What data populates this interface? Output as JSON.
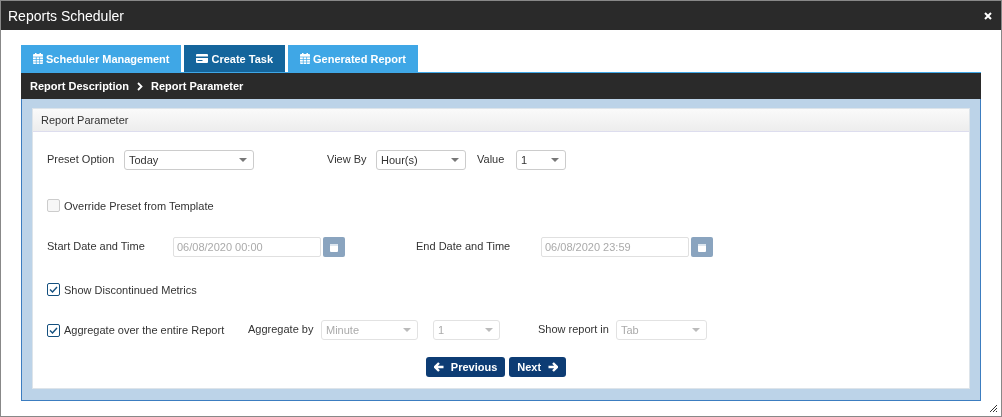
{
  "window": {
    "title": "Reports Scheduler"
  },
  "tabs": [
    {
      "label": "Scheduler Management",
      "kind": "calendar",
      "selected": false
    },
    {
      "label": "Create Task",
      "kind": "card",
      "selected": true
    },
    {
      "label": "Generated Report",
      "kind": "calendar",
      "selected": false
    }
  ],
  "breadcrumb": [
    "Report Description",
    "Report Parameter"
  ],
  "panel": {
    "title": "Report Parameter"
  },
  "preset_option": {
    "label": "Preset Option",
    "value": "Today",
    "disabled": false
  },
  "view_by": {
    "label": "View By",
    "value": "Hour(s)",
    "disabled": false
  },
  "value": {
    "label": "Value",
    "value": "1",
    "disabled": false
  },
  "override_preset": {
    "label": "Override Preset from Template",
    "checked": false,
    "disabled": true
  },
  "start": {
    "label": "Start Date and Time",
    "value": "06/08/2020 00:00",
    "disabled": true
  },
  "end": {
    "label": "End Date and Time",
    "value": "06/08/2020 23:59",
    "disabled": true
  },
  "show_discontinued": {
    "label": "Show Discontinued Metrics",
    "checked": true,
    "disabled": false
  },
  "aggregate": {
    "label": "Aggregate over the entire Report",
    "checked": true,
    "disabled": false
  },
  "aggregate_by": {
    "label": "Aggregate by",
    "value": "Minute",
    "disabled": true
  },
  "aggregate_count": {
    "value": "1",
    "disabled": true
  },
  "show_report_in": {
    "label": "Show report in",
    "value": "Tab",
    "disabled": true
  },
  "buttons": [
    {
      "label": "Previous",
      "kind": "back"
    },
    {
      "label": "Next",
      "kind": "forward"
    }
  ]
}
